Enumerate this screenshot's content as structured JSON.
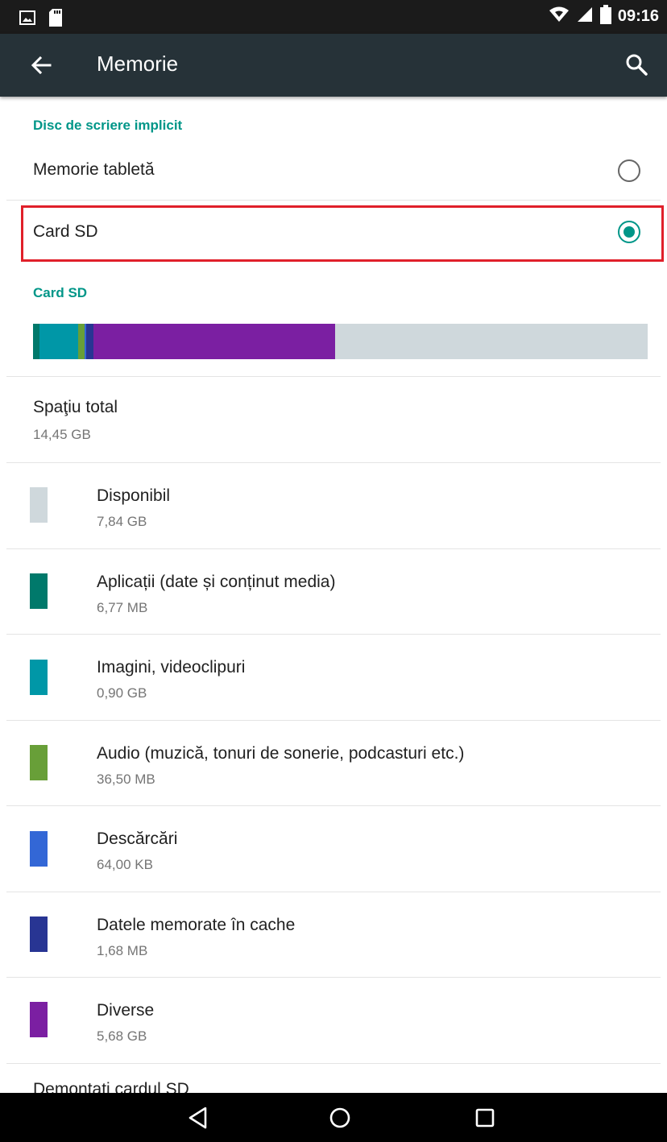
{
  "status_bar": {
    "time": "09:16",
    "icons": [
      "gallery-notification-icon",
      "sd-card-notification-icon",
      "wifi-icon",
      "signal-icon",
      "battery-icon"
    ]
  },
  "app_bar": {
    "title": "Memorie",
    "back_icon": "arrow-back-icon",
    "search_icon": "search-icon"
  },
  "default_disk": {
    "header": "Disc de scriere implicit",
    "options": [
      {
        "label": "Memorie tabletă",
        "selected": false
      },
      {
        "label": "Card SD",
        "selected": true
      }
    ]
  },
  "sd_card": {
    "header": "Card SD",
    "total_label": "Spaţiu total",
    "total_value": "14,45 GB",
    "categories": [
      {
        "label": "Disponibil",
        "value": "7,84 GB",
        "color": "#cfd8dc"
      },
      {
        "label": "Aplicații (date și conținut media)",
        "value": "6,77 MB",
        "color": "#00796b"
      },
      {
        "label": "Imagini, videoclipuri",
        "value": "0,90 GB",
        "color": "#0097a7"
      },
      {
        "label": "Audio (muzică, tonuri de sonerie, podcasturi etc.)",
        "value": "36,50 MB",
        "color": "#689f38"
      },
      {
        "label": "Descărcări",
        "value": "64,00 KB",
        "color": "#3367d6"
      },
      {
        "label": "Datele memorate în cache",
        "value": "1,68 MB",
        "color": "#283593"
      },
      {
        "label": "Diverse",
        "value": "5,68 GB",
        "color": "#7b1fa2"
      }
    ],
    "usage_bar_fractions": [
      {
        "color": "#00796b",
        "fraction": 0.011
      },
      {
        "color": "#0097a7",
        "fraction": 0.062
      },
      {
        "color": "#689f38",
        "fraction": 0.0115
      },
      {
        "color": "#3367d6",
        "fraction": 0.0025
      },
      {
        "color": "#283593",
        "fraction": 0.0115
      },
      {
        "color": "#7b1fa2",
        "fraction": 0.3925
      },
      {
        "color": "#cfd8dc",
        "fraction": 0.509
      }
    ],
    "unmount_label": "Demontaţi cardul SD"
  },
  "nav_bar": {
    "buttons": [
      "back-nav-icon",
      "home-icon",
      "recents-icon"
    ]
  },
  "colors": {
    "accent": "#009688",
    "app_bar": "#263238",
    "highlight": "#e0202a"
  }
}
